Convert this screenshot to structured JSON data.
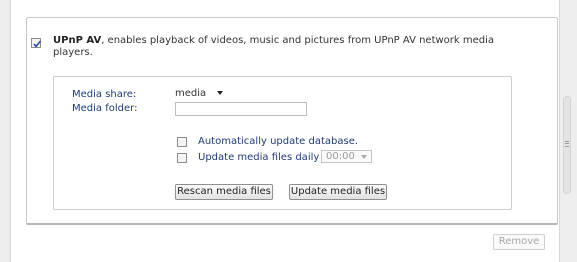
{
  "upnp": {
    "checked": true,
    "title": "UPnP AV",
    "description": ", enables playback of videos, music and pictures from UPnP AV network media players."
  },
  "media_share": {
    "label": "Media share:",
    "value": "media"
  },
  "media_folder": {
    "label": "Media folder:",
    "value": ""
  },
  "auto_update": {
    "label": "Automatically update database.",
    "checked": false
  },
  "daily_update": {
    "label": "Update media files daily at:",
    "checked": false,
    "time": "00:00"
  },
  "buttons": {
    "rescan": "Rescan media files",
    "update": "Update media files",
    "remove": "Remove"
  },
  "colors": {
    "label_blue": "#1f3b7a",
    "check_blue": "#2a4aa0"
  }
}
